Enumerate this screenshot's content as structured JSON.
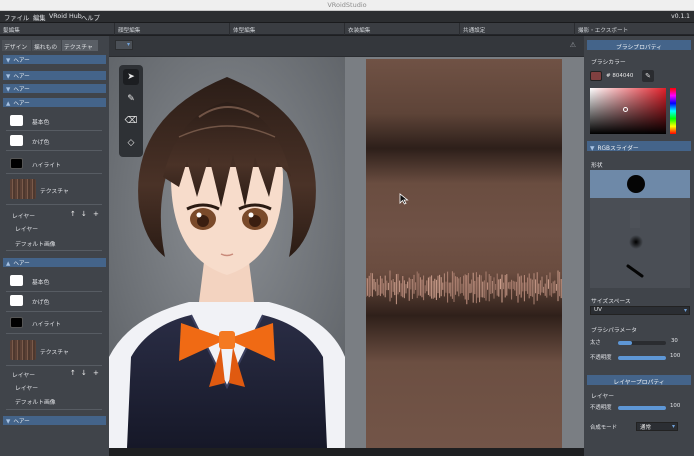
{
  "window": {
    "title": "VRoidStudio"
  },
  "menubar": {
    "items": [
      "ファイル",
      "編集",
      "VRoid Hub",
      "ヘルプ"
    ],
    "version": "v0.1.1"
  },
  "tabs": [
    "髪編集",
    "顔型編集",
    "体型編集",
    "衣装編集",
    "共通設定",
    "撮影・エクスポート"
  ],
  "left_panel": {
    "subtabs": [
      "デザイン",
      "揺れもの",
      "テクスチャ"
    ],
    "collapsed_sections": [
      "ヘアー",
      "ヘアー",
      "ヘアー",
      "ヘアー"
    ],
    "section_a": {
      "title": "ヘアー",
      "base_color_label": "基本色",
      "shadow_color_label": "かげ色",
      "highlight_label": "ハイライト",
      "texture_label": "テクスチャ",
      "layer_label": "レイヤー",
      "layer_controls": [
        "↑",
        "↓",
        "+"
      ],
      "layer_items": [
        "レイヤー",
        "デフォルト画像"
      ]
    },
    "section_b": {
      "title": "ヘアー",
      "base_color_label": "基本色",
      "shadow_color_label": "かげ色",
      "highlight_label": "ハイライト",
      "texture_label": "テクスチャ",
      "layer_label": "レイヤー",
      "layer_controls": [
        "↑",
        "↓",
        "+"
      ],
      "layer_items": [
        "レイヤー",
        "デフォルト画像"
      ]
    },
    "last_section": "ヘアー"
  },
  "toolbar": {
    "warning_icon": "⚠"
  },
  "tools": [
    {
      "name": "select",
      "glyph": "➤"
    },
    {
      "name": "pen",
      "glyph": "✎"
    },
    {
      "name": "eraser",
      "glyph": "⌫"
    },
    {
      "name": "fill",
      "glyph": "◇"
    }
  ],
  "right_panel": {
    "brush_header": "ブラシプロパティ",
    "brush_color_label": "ブラシカラー",
    "hex": "# 804040",
    "brush_color": "#804040",
    "rgb_slider_label": "RGBスライダー",
    "shape_label": "形状",
    "size_space_label": "サイズスペース",
    "size_space_value": "UV",
    "brush_params_label": "ブラシパラメータ",
    "thickness_label": "太さ",
    "thickness_value": "30",
    "thickness_fraction": 0.3,
    "opacity_label": "不透明度",
    "opacity_value": "100",
    "opacity_fraction": 1.0,
    "layer_header": "レイヤープロパティ",
    "layer_label": "レイヤー",
    "layer_opacity_label": "不透明度",
    "layer_opacity_value": "100",
    "layer_opacity_fraction": 1.0,
    "blend_label": "合成モード",
    "blend_value": "通常"
  },
  "colors": {
    "accent": "#44648a",
    "slider": "#5e97d6",
    "base": "#ffffff",
    "shadow": "#ffffff",
    "highlight": "#000000"
  }
}
